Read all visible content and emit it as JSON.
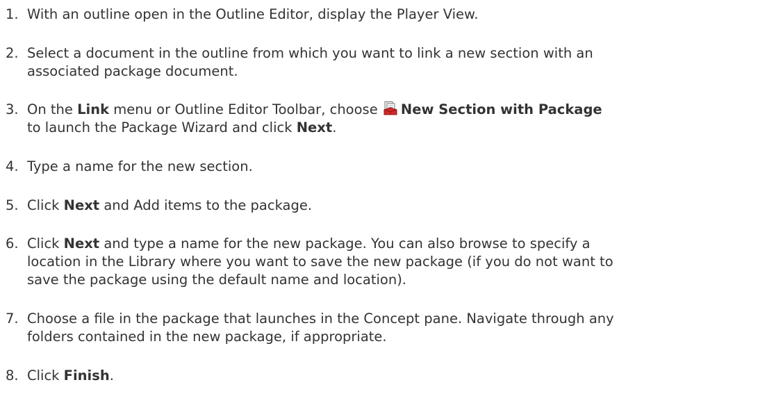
{
  "steps": [
    {
      "num": "1.",
      "l1": "With an outline open in the Outline Editor, display the Player View."
    },
    {
      "num": "2.",
      "l1": "Select a document in the outline from which you want to link a new section with an",
      "l2": "associated package document."
    },
    {
      "num": "3.",
      "l1a": "On the ",
      "l1b": "Link",
      "l1c": " menu or Outline Editor Toolbar, choose ",
      "icon": "new-section-with-package-icon",
      "l1d": "New Section with Package",
      "l2a": "to launch the Package Wizard and click ",
      "l2b": "Next",
      "l2c": "."
    },
    {
      "num": "4.",
      "l1": "Type a name for the new section."
    },
    {
      "num": "5.",
      "l1a": "Click ",
      "l1b": "Next",
      "l1c": " and Add items to the package."
    },
    {
      "num": "6.",
      "l1a": "Click ",
      "l1b": "Next",
      "l1c": " and type a name for the new package. You can also browse to specify a",
      "l2": "location in the Library where you want to save the new package (if you do not want to",
      "l3": "save the package using the default name and location)."
    },
    {
      "num": "7.",
      "l1": "Choose a file in the package that launches in the Concept pane. Navigate through any",
      "l2": "folders contained in the new package, if appropriate."
    },
    {
      "num": "8.",
      "l1a": "Click ",
      "l1b": "Finish",
      "l1c": "."
    }
  ],
  "colors": {
    "text": "#333333",
    "icon_red": "#d42a2a",
    "icon_page": "#f4f4f4"
  }
}
